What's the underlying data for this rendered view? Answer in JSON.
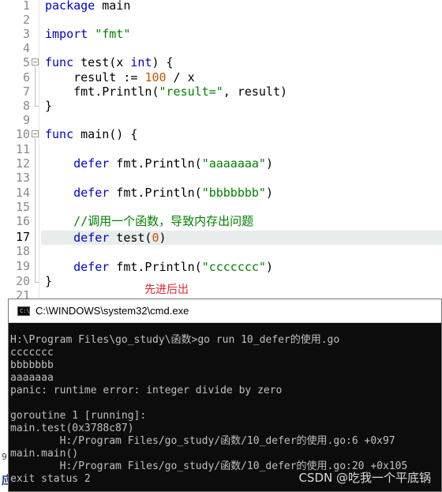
{
  "editor": {
    "line_numbers": [
      "1",
      "2",
      "3",
      "4",
      "5",
      "6",
      "7",
      "8",
      "9",
      "10",
      "11",
      "12",
      "13",
      "14",
      "15",
      "16",
      "17",
      "18",
      "19",
      "20",
      "21"
    ],
    "active_line": "17",
    "lines": {
      "l1_kw": "package",
      "l1_rest": " main",
      "l3_kw": "import",
      "l3_str": "\"fmt\"",
      "l5_kw": "func",
      "l5_a": " test(x ",
      "l5_kw2": "int",
      "l5_b": ") {",
      "l6_a": "    result := ",
      "l6_num": "100",
      "l6_b": " / x",
      "l7_a": "    fmt.Println(",
      "l7_str": "\"result=\"",
      "l7_b": ", result)",
      "l8": "}",
      "l10_kw": "func",
      "l10_rest": " main() {",
      "l12_kw": "    defer",
      "l12_a": " fmt.Println(",
      "l12_str": "\"aaaaaaa\"",
      "l12_b": ")",
      "l14_kw": "    defer",
      "l14_a": " fmt.Println(",
      "l14_str": "\"bbbbbbb\"",
      "l14_b": ")",
      "l16_cmt": "    //调用一个函数，导致内存出问题",
      "l17_kw": "    defer",
      "l17_a": " test(",
      "l17_num": "0",
      "l17_b": ")",
      "l19_kw": "    defer",
      "l19_a": " fmt.Println(",
      "l19_str": "\"ccccccc\"",
      "l19_b": ")",
      "l21": "}"
    },
    "annotation": "先进后出"
  },
  "cmd": {
    "title": "C:\\WINDOWS\\system32\\cmd.exe",
    "icon_label": "C:\\",
    "output": [
      "H:\\Program Files\\go_study\\函数>go run 10_defer的使用.go",
      "ccccccc",
      "bbbbbbb",
      "aaaaaaa",
      "panic: runtime error: integer divide by zero",
      "",
      "goroutine 1 [running]:",
      "main.test(0x3788c87)",
      "        H:/Program Files/go_study/函数/10_defer的使用.go:6 +0x97",
      "main.main()",
      "        H:/Program Files/go_study/函数/10_defer的使用.go:20 +0x105",
      "exit status 2"
    ]
  },
  "left_peek": {
    "a": "9",
    "b": "应"
  },
  "watermark": "CSDN @吃我一个平底锅",
  "colors": {
    "keyword": "#0000cc",
    "string": "#008000",
    "number": "#cc5500",
    "annotation": "#e22a2a",
    "console_bg": "#0c0c0c",
    "console_text": "#c0c0c0"
  }
}
